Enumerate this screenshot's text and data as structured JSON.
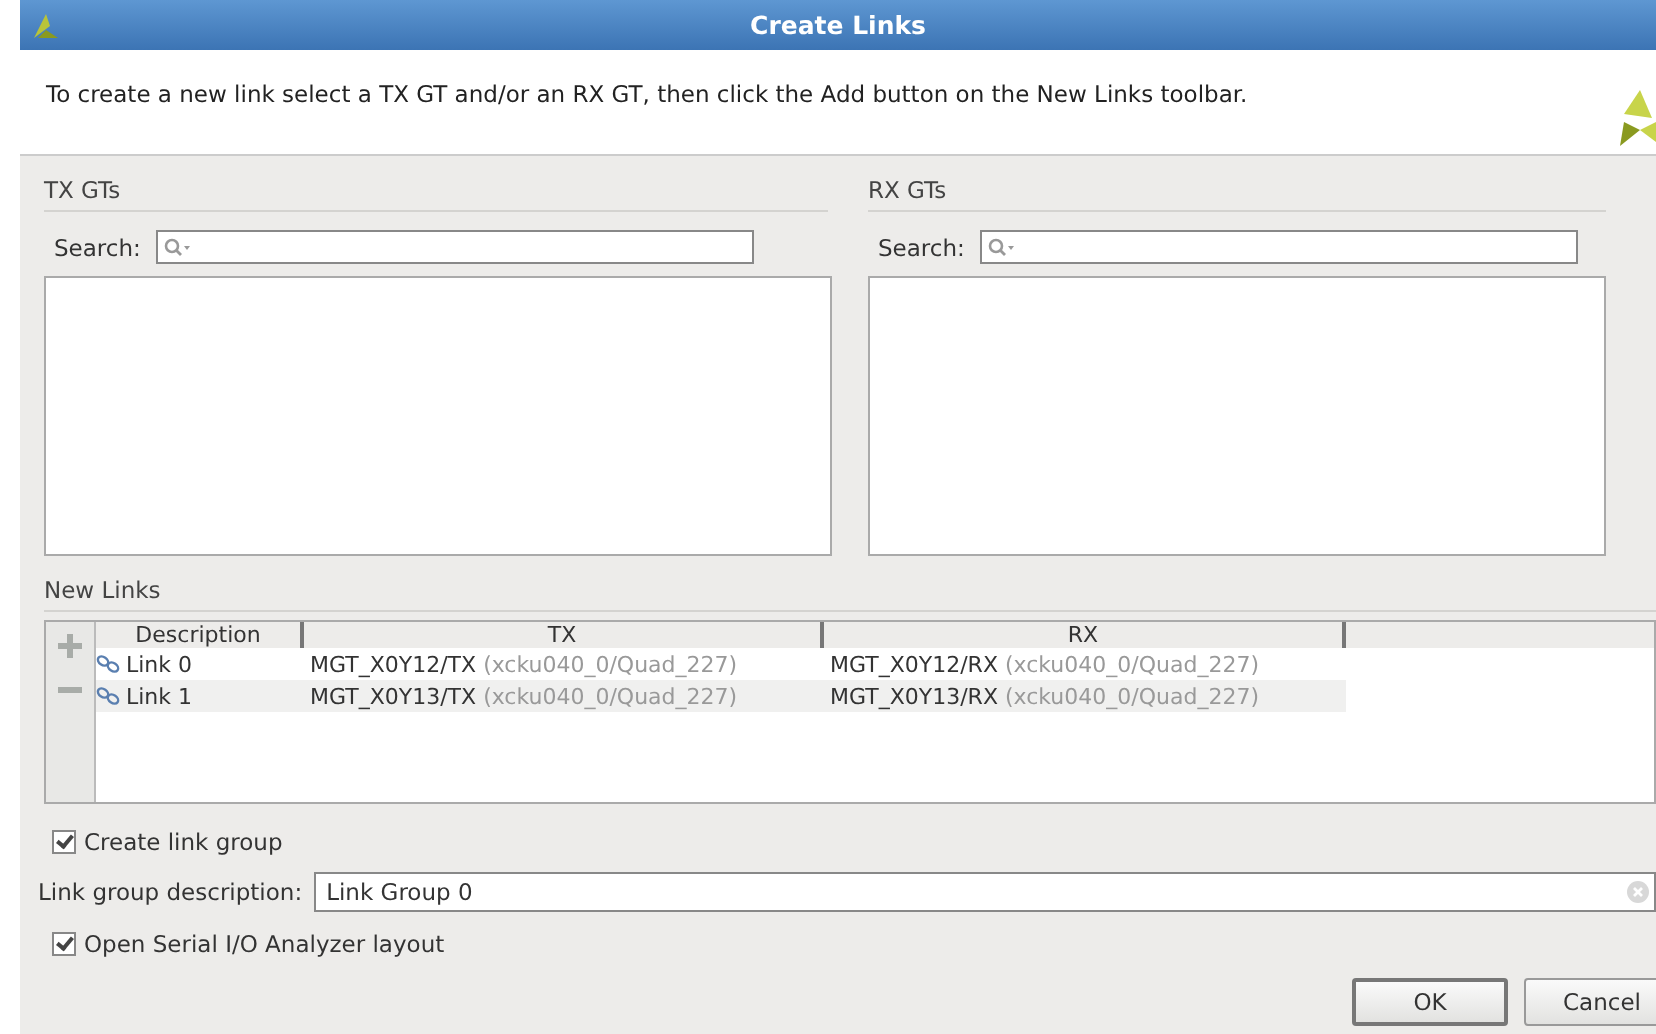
{
  "window": {
    "title": "Create Links"
  },
  "instructions": "To create a new link select a TX GT and/or an RX GT, then click the Add button on the New Links toolbar.",
  "panels": [
    {
      "title": "TX GTs",
      "search_label": "Search:"
    },
    {
      "title": "RX GTs",
      "search_label": "Search:"
    }
  ],
  "new_links": {
    "title": "New Links",
    "columns": [
      "Description",
      "TX",
      "RX"
    ],
    "rows": [
      {
        "description": "Link 0",
        "tx": "MGT_X0Y12/TX",
        "tx_detail": "(xcku040_0/Quad_227)",
        "rx": "MGT_X0Y12/RX",
        "rx_detail": "(xcku040_0/Quad_227)"
      },
      {
        "description": "Link 1",
        "tx": "MGT_X0Y13/TX",
        "tx_detail": "(xcku040_0/Quad_227)",
        "rx": "MGT_X0Y13/RX",
        "rx_detail": "(xcku040_0/Quad_227)"
      }
    ]
  },
  "create_link_group": {
    "label": "Create link group",
    "checked": true
  },
  "link_group_description": {
    "label": "Link group description:",
    "value": "Link Group 0"
  },
  "open_layout": {
    "label": "Open Serial I/O Analyzer layout",
    "checked": true
  },
  "buttons": [
    "OK",
    "Cancel"
  ]
}
